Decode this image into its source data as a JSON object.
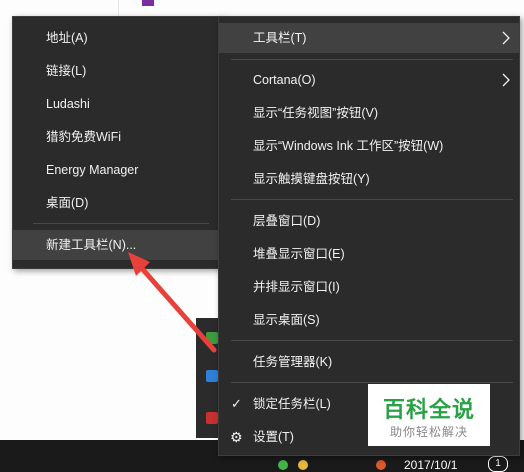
{
  "left_menu": {
    "items": [
      {
        "label": "地址(A)"
      },
      {
        "label": "链接(L)"
      },
      {
        "label": "Ludashi"
      },
      {
        "label": "猎豹免费WiFi"
      },
      {
        "label": "Energy Manager"
      },
      {
        "label": "桌面(D)"
      },
      {
        "label": "新建工具栏(N)..."
      }
    ]
  },
  "right_menu": {
    "items": [
      {
        "label": "工具栏(T)"
      },
      {
        "label": "Cortana(O)"
      },
      {
        "label": "显示“任务视图”按钮(V)"
      },
      {
        "label": "显示“Windows Ink 工作区”按钮(W)"
      },
      {
        "label": "显示触摸键盘按钮(Y)"
      },
      {
        "label": "层叠窗口(D)"
      },
      {
        "label": "堆叠显示窗口(E)"
      },
      {
        "label": "并排显示窗口(I)"
      },
      {
        "label": "显示桌面(S)"
      },
      {
        "label": "任务管理器(K)"
      },
      {
        "label": "锁定任务栏(L)"
      },
      {
        "label": "设置(T)"
      }
    ]
  },
  "taskbar": {
    "date": "2017/10/1",
    "badge": "1"
  },
  "watermark": {
    "title": "百科全说",
    "subtitle": "助你轻松解决"
  },
  "colors": {
    "menu_bg": "#2b2b2b",
    "highlight": "#414141",
    "arrow": "#e8403a",
    "watermark_green": "#2aa146"
  },
  "icons": {
    "submenu": "chevron-right-icon",
    "checked": "check-icon",
    "settings": "gear-icon"
  }
}
